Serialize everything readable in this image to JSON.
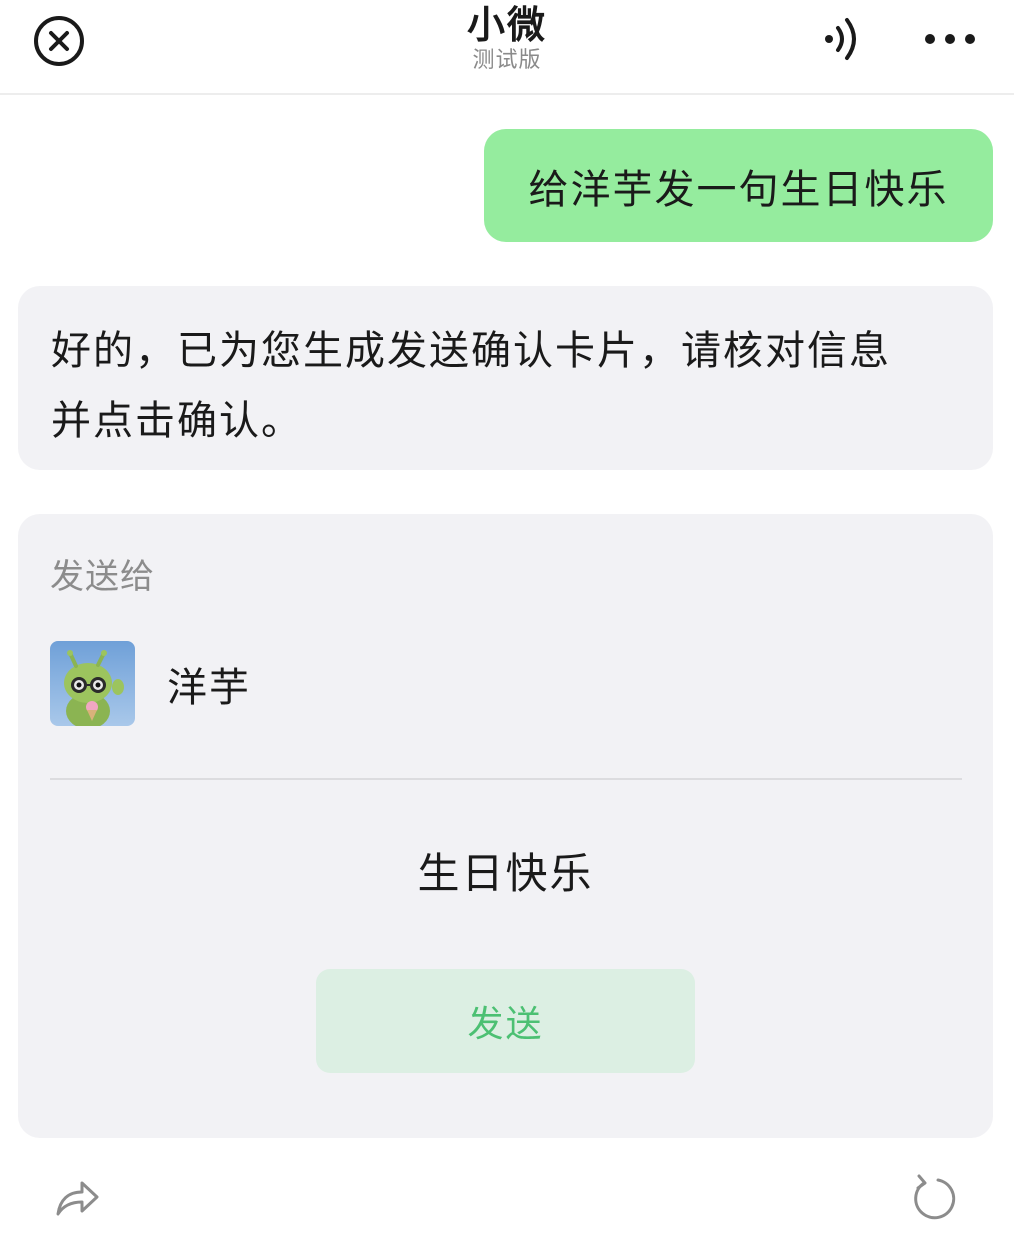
{
  "header": {
    "title": "小微",
    "subtitle": "测试版",
    "close_icon": "close-circle-icon",
    "voice_icon": "voice-icon",
    "more_icon": "more-dots-icon"
  },
  "chat": {
    "user_message": "给洋芋发一句生日快乐",
    "bot_message_line1": "好的，已为您生成发送确认卡片，请核对信息",
    "bot_message_line2": "并点击确认。"
  },
  "card": {
    "label": "发送给",
    "recipient_name": "洋芋",
    "message": "生日快乐",
    "send_label": "发送"
  },
  "footer": {
    "share_icon": "share-icon",
    "refresh_icon": "refresh-icon"
  },
  "colors": {
    "user_bubble": "#95ec9e",
    "bot_bubble": "#f2f2f5",
    "send_button_bg": "#dcefe3",
    "send_button_text": "#4cc073"
  }
}
